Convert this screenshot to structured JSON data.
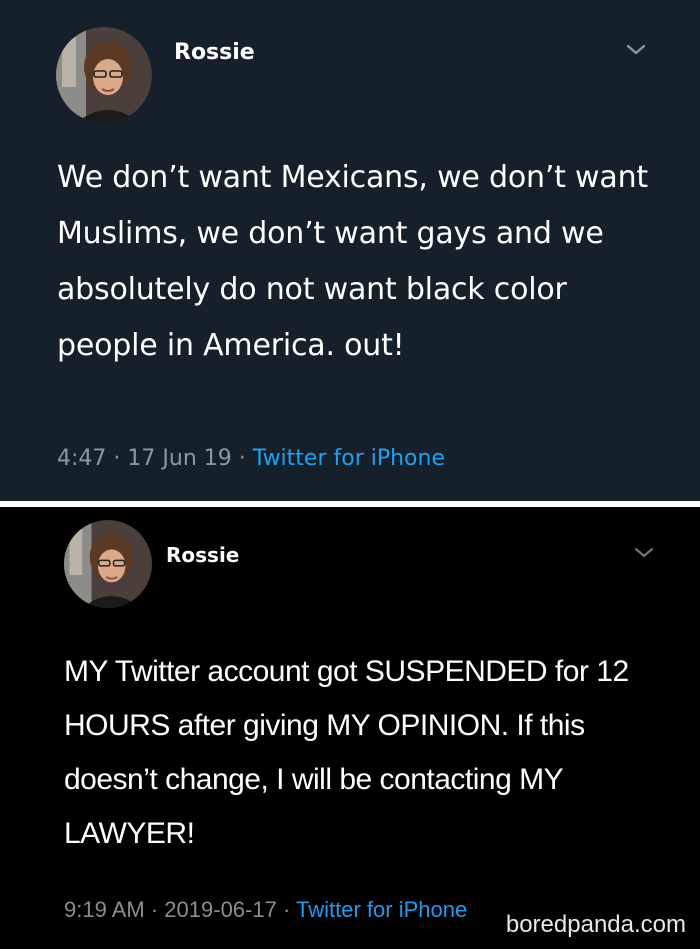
{
  "colors": {
    "tweet1_background": "#15202b",
    "tweet2_background": "#000000",
    "separator": "#ffffff",
    "text": "#ffffff",
    "meta_text": "#8899a6",
    "link": "#1da1f2"
  },
  "tweets": [
    {
      "username": "Rossie",
      "body": "We don’t want Mexicans, we don’t want Muslims, we don’t want gays and we absolutely do not want black color people in America. out!",
      "time": "4:47",
      "separator_1": "·",
      "date": "17 Jun 19",
      "separator_2": "·",
      "source": "Twitter for iPhone",
      "menu_icon": "chevron-down-icon"
    },
    {
      "username": "Rossie",
      "body": "MY Twitter account got SUSPENDED for 12 HOURS after giving MY OPINION. If this doesn’t change, I will be contacting MY LAWYER!",
      "time": "9:19 AM",
      "separator_1": "·",
      "date": "2019-06-17",
      "separator_2": "·",
      "source": "Twitter for iPhone",
      "menu_icon": "chevron-down-icon"
    }
  ],
  "watermark": "boredpanda.com"
}
